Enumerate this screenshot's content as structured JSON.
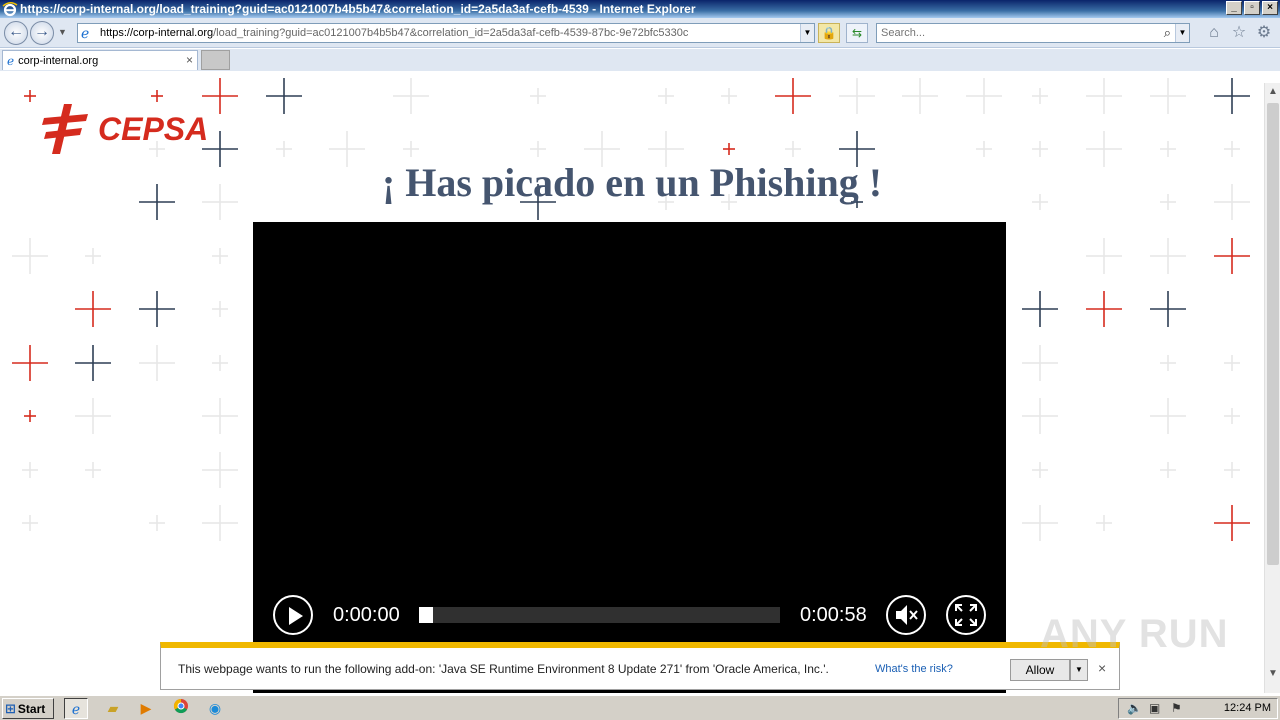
{
  "window": {
    "title": "https://corp-internal.org/load_training?guid=ac0121007b4b5b47&correlation_id=2a5da3af-cefb-4539 - Internet Explorer",
    "minimize": "_",
    "maximize": "▫",
    "close": "×"
  },
  "navbar": {
    "url_host": "https://corp-internal.org",
    "url_rest": "/load_training?guid=ac0121007b4b5b47&correlation_id=2a5da3af-cefb-4539-87bc-9e72bfc5330c",
    "search_placeholder": "Search..."
  },
  "tabs": [
    {
      "label": "corp-internal.org"
    }
  ],
  "page": {
    "logo_text": "CEPSA",
    "title": "¡ Has picado en un Phishing !",
    "brand_red": "#d52b1e",
    "title_color": "#45556f"
  },
  "video": {
    "time_current": "0:00:00",
    "time_total": "0:00:58",
    "progress": 0.04
  },
  "notification": {
    "message": "This webpage wants to run the following add-on: 'Java SE Runtime Environment 8 Update 271' from 'Oracle America, Inc.'.",
    "risk_link": "What's the risk?",
    "allow_label": "Allow"
  },
  "watermark": "ANY RUN",
  "taskbar": {
    "start_label": "Start",
    "clock": "12:24 PM"
  }
}
